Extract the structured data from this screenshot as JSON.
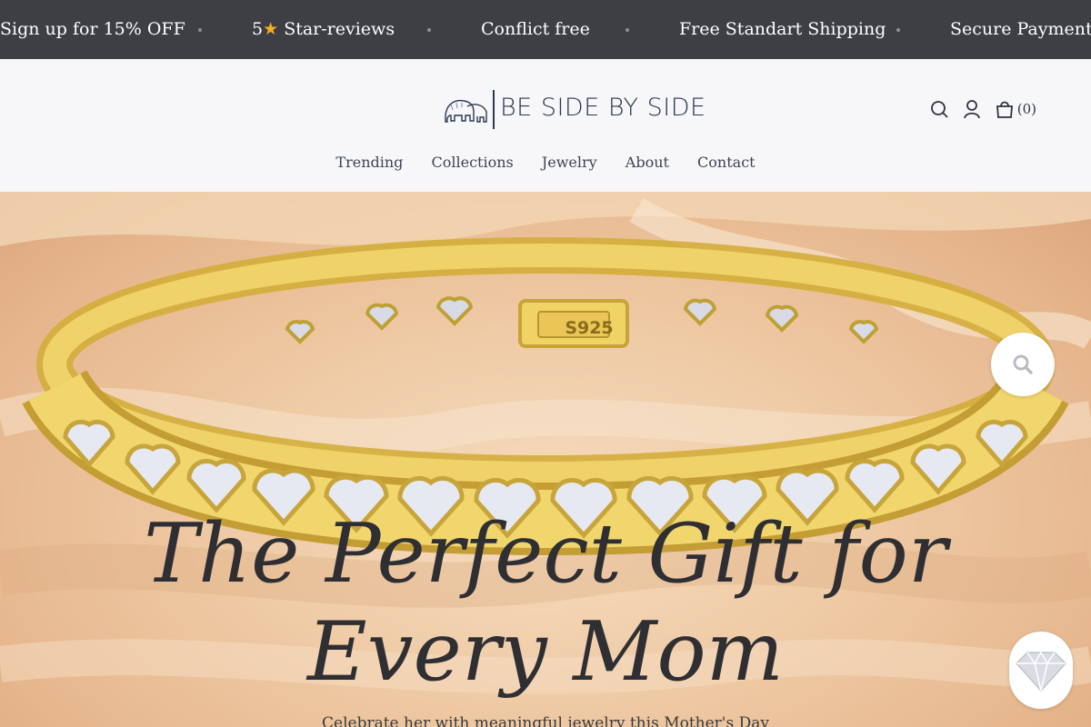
{
  "announcement": {
    "items": [
      "Sign up for 15% OFF",
      "Star-reviews",
      "Conflict free",
      "Free Standart Shipping",
      "Secure Payments"
    ],
    "star_prefix": "5",
    "star_glyph": "★"
  },
  "header": {
    "logo_text": "BE SIDE BY SIDE",
    "cart_count": "(0)",
    "icons": [
      "search-icon",
      "account-icon",
      "cart-icon"
    ]
  },
  "nav": {
    "items": [
      "Trending",
      "Collections",
      "Jewelry",
      "About",
      "Contact"
    ]
  },
  "hero": {
    "title_line1": "The Perfect Gift for",
    "title_line2": "Every Mom",
    "subtitle": "Celebrate her with meaningful jewelry this Mother's Day",
    "bracelet_stamp": "S925",
    "zoom_icon": "magnifier-icon",
    "gem_icon": "diamond-icon"
  },
  "colors": {
    "announcement_bg": "#3d3f44",
    "brand": "#2c3752",
    "gold": "#e6c64a",
    "star": "#f2b01e"
  }
}
